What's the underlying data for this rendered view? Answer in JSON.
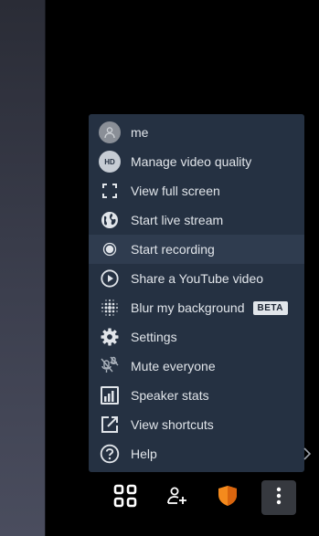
{
  "menu": {
    "items": [
      {
        "label": "me",
        "icon": "avatar"
      },
      {
        "label": "Manage video quality",
        "icon": "hd-icon",
        "icon_text": "HD"
      },
      {
        "label": "View full screen",
        "icon": "fullscreen-icon"
      },
      {
        "label": "Start live stream",
        "icon": "globe-icon"
      },
      {
        "label": "Start recording",
        "icon": "record-icon"
      },
      {
        "label": "Share a YouTube video",
        "icon": "play-circle-icon"
      },
      {
        "label": "Blur my background",
        "icon": "blur-icon",
        "badge": "BETA"
      },
      {
        "label": "Settings",
        "icon": "gear-icon"
      },
      {
        "label": "Mute everyone",
        "icon": "mic-muted-icon"
      },
      {
        "label": "Speaker stats",
        "icon": "bar-chart-icon"
      },
      {
        "label": "View shortcuts",
        "icon": "open-external-icon"
      },
      {
        "label": "Help",
        "icon": "help-icon"
      }
    ]
  },
  "toolbar": {
    "buttons": [
      {
        "name": "tile-view",
        "icon": "grid-icon"
      },
      {
        "name": "invite",
        "icon": "add-person-icon"
      },
      {
        "name": "security",
        "icon": "shield-icon"
      },
      {
        "name": "more",
        "icon": "more-vertical-icon"
      }
    ]
  },
  "colors": {
    "menu_bg": "#253142",
    "menu_highlight": "#2f3c4f",
    "text": "#e1e5ea",
    "shield": "#f48a1d",
    "background": "#000000"
  }
}
